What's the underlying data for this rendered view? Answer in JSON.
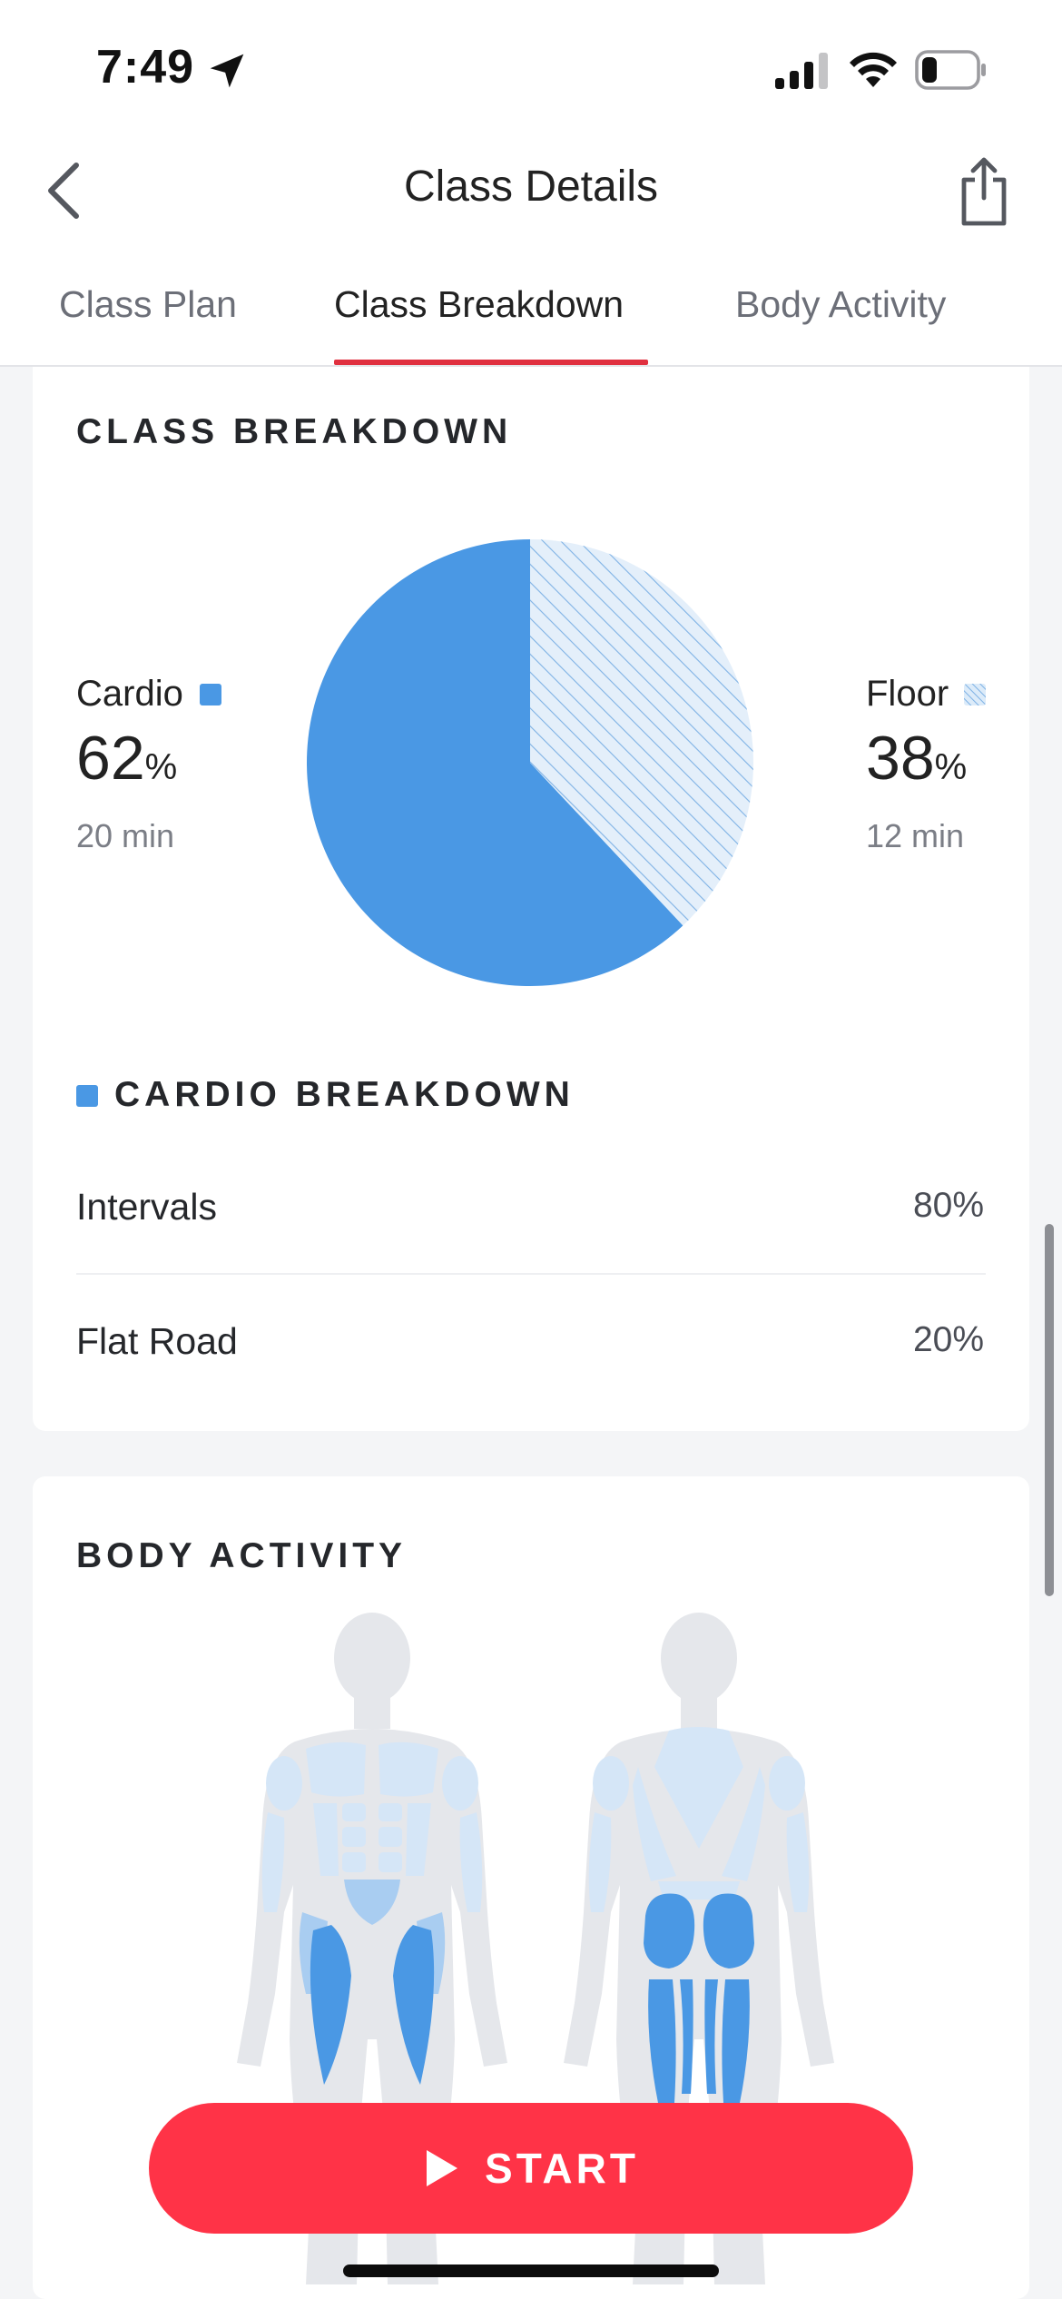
{
  "status_bar": {
    "time": "7:49"
  },
  "nav": {
    "title": "Class Details"
  },
  "tabs": [
    {
      "label": "Class Plan",
      "active": false
    },
    {
      "label": "Class Breakdown",
      "active": true
    },
    {
      "label": "Body Activity",
      "active": false
    }
  ],
  "class_breakdown": {
    "heading": "CLASS BREAKDOWN",
    "segments": [
      {
        "name": "Cardio",
        "percent_value": "62",
        "percent_unit": "%",
        "minutes": "20 min",
        "fraction": 0.62,
        "color": "#4a98e4"
      },
      {
        "name": "Floor",
        "percent_value": "38",
        "percent_unit": "%",
        "minutes": "12 min",
        "fraction": 0.38,
        "color": "#cfe3f6"
      }
    ]
  },
  "cardio_breakdown": {
    "heading": "CARDIO BREAKDOWN",
    "rows": [
      {
        "label": "Intervals",
        "value": "80%"
      },
      {
        "label": "Flat Road",
        "value": "20%"
      }
    ]
  },
  "body_activity": {
    "heading": "BODY ACTIVITY",
    "colors": {
      "silhouette": "#e5e7eb",
      "low": "#d5e6f7",
      "medium": "#a9cdf1",
      "high": "#4a98e4"
    }
  },
  "start_button": {
    "label": "START",
    "color": "#ff3347"
  },
  "colors": {
    "accent": "#e0303f",
    "cardio": "#4a98e4"
  }
}
